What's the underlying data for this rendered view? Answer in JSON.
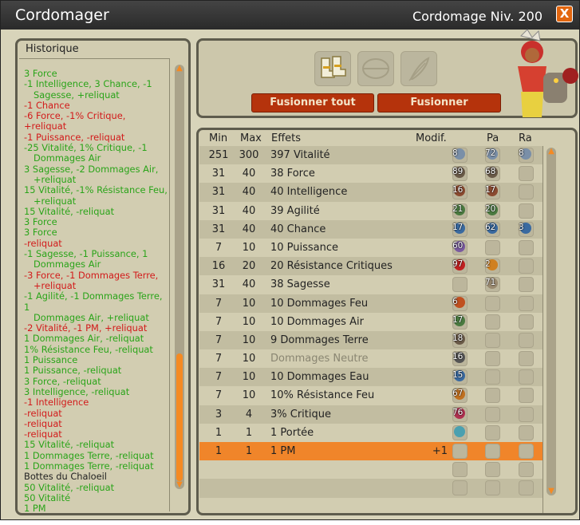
{
  "window": {
    "title": "Cordomager",
    "level": "Cordomage Niv. 200",
    "close": "X"
  },
  "history": {
    "title": "Historique",
    "items": [
      {
        "lines": [
          "3 Force"
        ],
        "color": "g"
      },
      {
        "lines": [
          "-1 Intelligence, 3 Chance, -1",
          "Sagesse, +reliquat"
        ],
        "color": "g"
      },
      {
        "lines": [
          "-1 Chance"
        ],
        "color": "r"
      },
      {
        "lines": [
          "-6 Force, -1% Critique, +reliquat"
        ],
        "color": "r"
      },
      {
        "lines": [
          "-1 Puissance, -reliquat"
        ],
        "color": "r"
      },
      {
        "lines": [
          "-25 Vitalité, 1% Critique, -1",
          "Dommages Air"
        ],
        "color": "g"
      },
      {
        "lines": [
          "3 Sagesse, -2 Dommages Air,",
          "+reliquat"
        ],
        "color": "g"
      },
      {
        "lines": [
          "15 Vitalité, -1% Résistance Feu,",
          "+reliquat"
        ],
        "color": "g"
      },
      {
        "lines": [
          "15 Vitalité, -reliquat"
        ],
        "color": "g"
      },
      {
        "lines": [
          "3 Force"
        ],
        "color": "g"
      },
      {
        "lines": [
          "3 Force"
        ],
        "color": "g"
      },
      {
        "lines": [
          "-reliquat"
        ],
        "color": "r"
      },
      {
        "lines": [
          "-1 Sagesse, -1 Puissance, 1",
          "Dommages Air"
        ],
        "color": "g"
      },
      {
        "lines": [
          "-3 Force, -1 Dommages Terre,",
          "+reliquat"
        ],
        "color": "r"
      },
      {
        "lines": [
          "-1 Agilité, -1 Dommages Terre, 1",
          "Dommages Air, +reliquat"
        ],
        "color": "g"
      },
      {
        "lines": [
          "-2 Vitalité, -1 PM, +reliquat"
        ],
        "color": "r"
      },
      {
        "lines": [
          "1 Dommages Air, -reliquat"
        ],
        "color": "g"
      },
      {
        "lines": [
          "1% Résistance Feu, -reliquat"
        ],
        "color": "g"
      },
      {
        "lines": [
          "1 Puissance"
        ],
        "color": "g"
      },
      {
        "lines": [
          "1 Puissance, -reliquat"
        ],
        "color": "g"
      },
      {
        "lines": [
          "3 Force, -reliquat"
        ],
        "color": "g"
      },
      {
        "lines": [
          "3 Intelligence, -reliquat"
        ],
        "color": "g"
      },
      {
        "lines": [
          "-1 Intelligence"
        ],
        "color": "r"
      },
      {
        "lines": [
          "-reliquat"
        ],
        "color": "r"
      },
      {
        "lines": [
          "-reliquat"
        ],
        "color": "r"
      },
      {
        "lines": [
          "-reliquat"
        ],
        "color": "r"
      },
      {
        "lines": [
          "15 Vitalité, -reliquat"
        ],
        "color": "g"
      },
      {
        "lines": [
          "1 Dommages Terre, -reliquat"
        ],
        "color": "g"
      },
      {
        "lines": [
          "1 Dommages Terre, -reliquat"
        ],
        "color": "g"
      },
      {
        "lines": [
          "Bottes du Chaloeil"
        ],
        "color": "k"
      },
      {
        "lines": [
          "50 Vitalité, -reliquat"
        ],
        "color": "g"
      },
      {
        "lines": [
          "50 Vitalité"
        ],
        "color": "g"
      },
      {
        "lines": [
          "1 PM"
        ],
        "color": "g"
      }
    ]
  },
  "fusion": {
    "fuse_all": "Fusionner tout",
    "fuse": "Fusionner"
  },
  "table": {
    "headers": {
      "min": "Min",
      "max": "Max",
      "effects": "Effets",
      "modif": "Modif.",
      "pa": "Pa",
      "ra": "Ra"
    },
    "rows": [
      {
        "min": "251",
        "max": "300",
        "effect": "397 Vitalité",
        "modif": "",
        "runes": [
          "8",
          "72",
          "8"
        ],
        "colors": [
          "#7a8fa8",
          "#7a8fa8",
          "#7a8fa8"
        ]
      },
      {
        "min": "31",
        "max": "40",
        "effect": "38 Force",
        "modif": "",
        "runes": [
          "89",
          "68",
          ""
        ],
        "colors": [
          "#6a5a48",
          "#6a5a48",
          ""
        ]
      },
      {
        "min": "31",
        "max": "40",
        "effect": "40 Intelligence",
        "modif": "",
        "runes": [
          "16",
          "17",
          ""
        ],
        "colors": [
          "#8a4a30",
          "#8a4a30",
          ""
        ]
      },
      {
        "min": "31",
        "max": "40",
        "effect": "39 Agilité",
        "modif": "",
        "runes": [
          "21",
          "20",
          ""
        ],
        "colors": [
          "#4a7a40",
          "#4a7a40",
          ""
        ]
      },
      {
        "min": "31",
        "max": "40",
        "effect": "40 Chance",
        "modif": "",
        "runes": [
          "17",
          "62",
          "3"
        ],
        "colors": [
          "#3a6aa0",
          "#3a6aa0",
          "#3a6aa0"
        ]
      },
      {
        "min": "7",
        "max": "10",
        "effect": "10 Puissance",
        "modif": "",
        "runes": [
          "60",
          "",
          ""
        ],
        "colors": [
          "#7a5aa0",
          "",
          ""
        ]
      },
      {
        "min": "16",
        "max": "20",
        "effect": "20 Résistance Critiques",
        "modif": "",
        "runes": [
          "97",
          "2",
          ""
        ],
        "colors": [
          "#c02020",
          "#d08020",
          ""
        ]
      },
      {
        "min": "31",
        "max": "40",
        "effect": "38 Sagesse",
        "modif": "",
        "runes": [
          "",
          "71",
          ""
        ],
        "colors": [
          "",
          "#9a8a70",
          ""
        ]
      },
      {
        "min": "7",
        "max": "10",
        "effect": "10 Dommages Feu",
        "modif": "",
        "runes": [
          "6",
          "",
          ""
        ],
        "colors": [
          "#c05020",
          "",
          ""
        ]
      },
      {
        "min": "7",
        "max": "10",
        "effect": "10 Dommages Air",
        "modif": "",
        "runes": [
          "17",
          "",
          ""
        ],
        "colors": [
          "#4a7a40",
          "",
          ""
        ]
      },
      {
        "min": "7",
        "max": "10",
        "effect": "9 Dommages Terre",
        "modif": "",
        "runes": [
          "18",
          "",
          ""
        ],
        "colors": [
          "#6a5a48",
          "",
          ""
        ]
      },
      {
        "min": "7",
        "max": "10",
        "effect": "Dommages Neutre",
        "modif": "",
        "runes": [
          "16",
          "",
          ""
        ],
        "colors": [
          "#555555",
          "",
          ""
        ],
        "grey": true
      },
      {
        "min": "7",
        "max": "10",
        "effect": "10 Dommages Eau",
        "modif": "",
        "runes": [
          "15",
          "",
          ""
        ],
        "colors": [
          "#3a6aa0",
          "",
          ""
        ]
      },
      {
        "min": "7",
        "max": "10",
        "effect": "10% Résistance Feu",
        "modif": "",
        "runes": [
          "67",
          "",
          ""
        ],
        "colors": [
          "#c07020",
          "",
          ""
        ]
      },
      {
        "min": "3",
        "max": "4",
        "effect": "3% Critique",
        "modif": "",
        "runes": [
          "76",
          "",
          ""
        ],
        "colors": [
          "#b03050",
          "",
          ""
        ]
      },
      {
        "min": "1",
        "max": "1",
        "effect": "1 Portée",
        "modif": "",
        "runes": [
          "",
          "",
          ""
        ],
        "colors": [
          "#4aa0b0",
          "",
          ""
        ]
      },
      {
        "min": "1",
        "max": "1",
        "effect": "1 PM",
        "modif": "+1",
        "runes": [
          "",
          "",
          ""
        ],
        "colors": [
          "",
          "",
          ""
        ],
        "selected": true
      }
    ]
  },
  "colors": {
    "accent": "#f0852a",
    "button": "#b5330c",
    "positive": "#2aa419",
    "negative": "#d21a1a"
  }
}
